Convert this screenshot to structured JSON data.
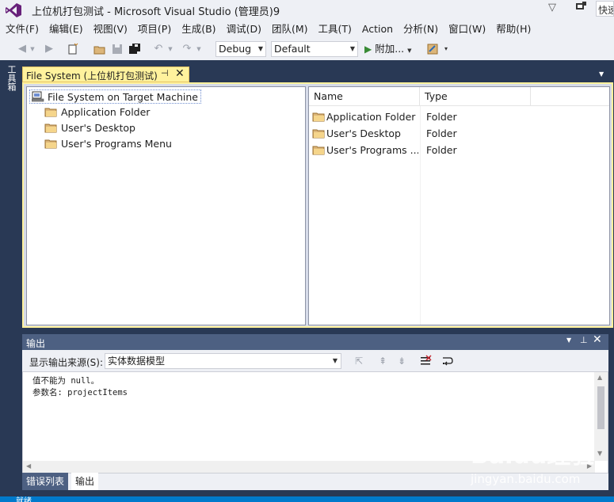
{
  "window": {
    "title": "上位机打包测试 - Microsoft Visual Studio (管理员)9",
    "quick_launch": "快速"
  },
  "menu": [
    "文件(F)",
    "编辑(E)",
    "视图(V)",
    "项目(P)",
    "生成(B)",
    "调试(D)",
    "团队(M)",
    "工具(T)",
    "Action",
    "分析(N)",
    "窗口(W)",
    "帮助(H)"
  ],
  "toolbar": {
    "config": "Debug",
    "platform": "Default",
    "attach_label": "附加..."
  },
  "side_rail": {
    "toolbox_label": "工具箱"
  },
  "doc_tab": {
    "label": "File System (上位机打包测试)"
  },
  "tree": {
    "root": "File System on Target Machine",
    "items": [
      "Application Folder",
      "User's Desktop",
      "User's Programs Menu"
    ]
  },
  "list": {
    "columns": [
      "Name",
      "Type"
    ],
    "rows": [
      {
        "name": "Application Folder",
        "type": "Folder"
      },
      {
        "name": "User's Desktop",
        "type": "Folder"
      },
      {
        "name": "User's Programs ...",
        "type": "Folder"
      }
    ]
  },
  "output": {
    "title": "输出",
    "source_label": "显示输出来源(S):",
    "source_value": "实体数据模型",
    "lines": [
      "值不能为 null。",
      "参数名: projectItems"
    ]
  },
  "bottom_tabs": [
    "错误列表",
    "输出"
  ],
  "status": {
    "text": "就绪"
  },
  "watermark": {
    "brand": "Baidu经验",
    "url": "jingyan.baidu.com"
  },
  "colors": {
    "accent": "#007acc",
    "tab_active": "#fff29d",
    "panel_title": "#4d6082"
  }
}
